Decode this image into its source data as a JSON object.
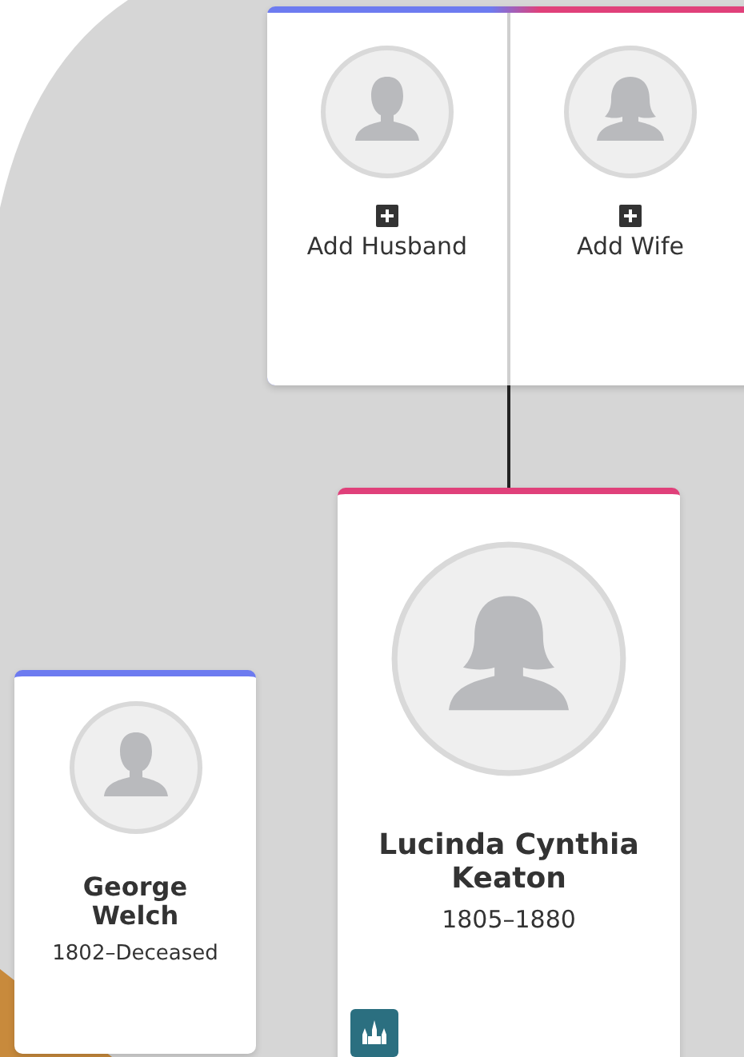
{
  "parents": [
    {
      "kind": "male",
      "label": "Add Husband"
    },
    {
      "kind": "female",
      "label": "Add Wife"
    }
  ],
  "spouse": {
    "kind": "male",
    "name": "George Welch",
    "dates": "1802–Deceased"
  },
  "person": {
    "kind": "female",
    "name": "Lucinda Cynthia Keaton",
    "dates": "1805–1880",
    "temple": true
  }
}
